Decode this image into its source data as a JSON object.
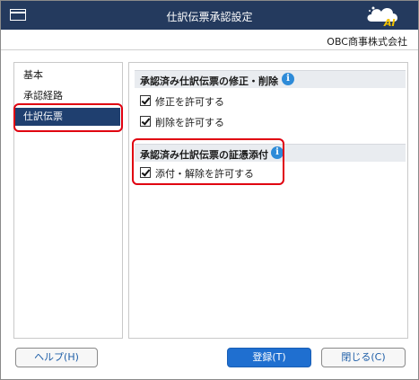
{
  "window": {
    "title": "仕訳伝票承認設定",
    "logo_text": "AI"
  },
  "company": "OBC商事株式会社",
  "nav": {
    "items": [
      "基本",
      "承認経路",
      "仕訳伝票"
    ],
    "selected": "仕訳伝票"
  },
  "sections": {
    "edit": {
      "header": "承認済み仕訳伝票の修正・削除",
      "options": [
        {
          "label": "修正を許可する",
          "checked": true
        },
        {
          "label": "削除を許可する",
          "checked": true
        }
      ]
    },
    "attach": {
      "header": "承認済み仕訳伝票の証憑添付",
      "options": [
        {
          "label": "添付・解除を許可する",
          "checked": true
        }
      ]
    }
  },
  "buttons": {
    "help": "ヘルプ(H)",
    "register": "登録(T)",
    "close": "閉じる(C)"
  },
  "colors": {
    "titlebar": "#243a5e",
    "selected_nav": "#1f3f6f",
    "highlight": "#e00010",
    "primary": "#1f6fd0",
    "info": "#2e8bd8"
  }
}
